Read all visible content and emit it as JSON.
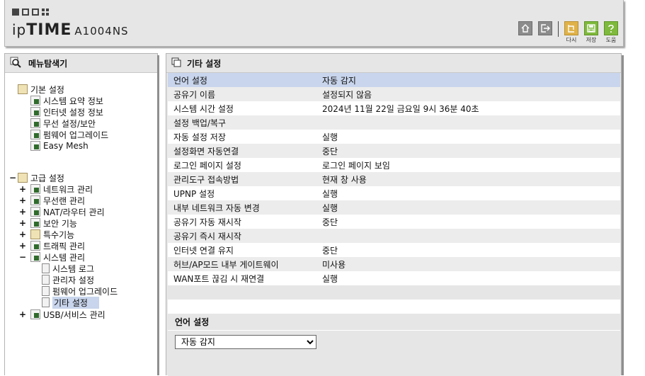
{
  "header": {
    "brand_ip": "ip",
    "brand_time": "TIME",
    "model": "A1004NS",
    "buttons": [
      {
        "name": "home",
        "label": ""
      },
      {
        "name": "logout",
        "label": ""
      },
      {
        "name": "restore",
        "label": "다시"
      },
      {
        "name": "save",
        "label": "저장"
      },
      {
        "name": "help",
        "label": "도움"
      }
    ]
  },
  "sidebar": {
    "title": "메뉴탐색기",
    "basic_group": "기본 설정",
    "basic_items": [
      "시스템 요약 정보",
      "인터넷 설정 정보",
      "무선 설정/보안",
      "펌웨어 업그레이드",
      "Easy Mesh"
    ],
    "advanced_group": "고급 설정",
    "advanced_items": [
      "네트워크 관리",
      "무선랜 관리",
      "NAT/라우터 관리",
      "보안 기능",
      "특수기능",
      "트래픽 관리",
      "시스템 관리",
      "USB/서비스 관리"
    ],
    "system_sub_items": [
      "시스템 로그",
      "관리자 설정",
      "펌웨어 업그레이드",
      "기타 설정"
    ],
    "toggles": {
      "minus": "−",
      "plus": "+"
    }
  },
  "main": {
    "title": "기타 설정",
    "rows": [
      {
        "key": "언어 설정",
        "value": "자동 감지"
      },
      {
        "key": "공유기 이름",
        "value": "설정되지 않음"
      },
      {
        "key": "시스템 시간 설정",
        "value": "2024년 11월 22일 금요일 9시 36분 40초"
      },
      {
        "key": "설정 백업/복구",
        "value": ""
      },
      {
        "key": "자동 설정 저장",
        "value": "실행"
      },
      {
        "key": "설정화면 자동연결",
        "value": "중단"
      },
      {
        "key": "로그인 페이지 설정",
        "value": "로그인 페이지 보임"
      },
      {
        "key": "관리도구 접속방법",
        "value": "현재 창 사용"
      },
      {
        "key": "UPNP 설정",
        "value": "실행"
      },
      {
        "key": "내부 네트워크 자동 변경",
        "value": "실행"
      },
      {
        "key": "공유기 자동 재시작",
        "value": "중단"
      },
      {
        "key": "공유기 즉시 재시작",
        "value": ""
      },
      {
        "key": "인터넷 연결 유지",
        "value": "중단"
      },
      {
        "key": "허브/AP모드 내부 게이트웨이",
        "value": "미사용"
      },
      {
        "key": "WAN포트 끊김 시 재연결",
        "value": "실행"
      }
    ]
  },
  "settings": {
    "title": "언어 설정",
    "select_value": "자동 감지"
  },
  "colors": {
    "panel": "#e6e6e6",
    "selected": "#c8d5ec"
  }
}
